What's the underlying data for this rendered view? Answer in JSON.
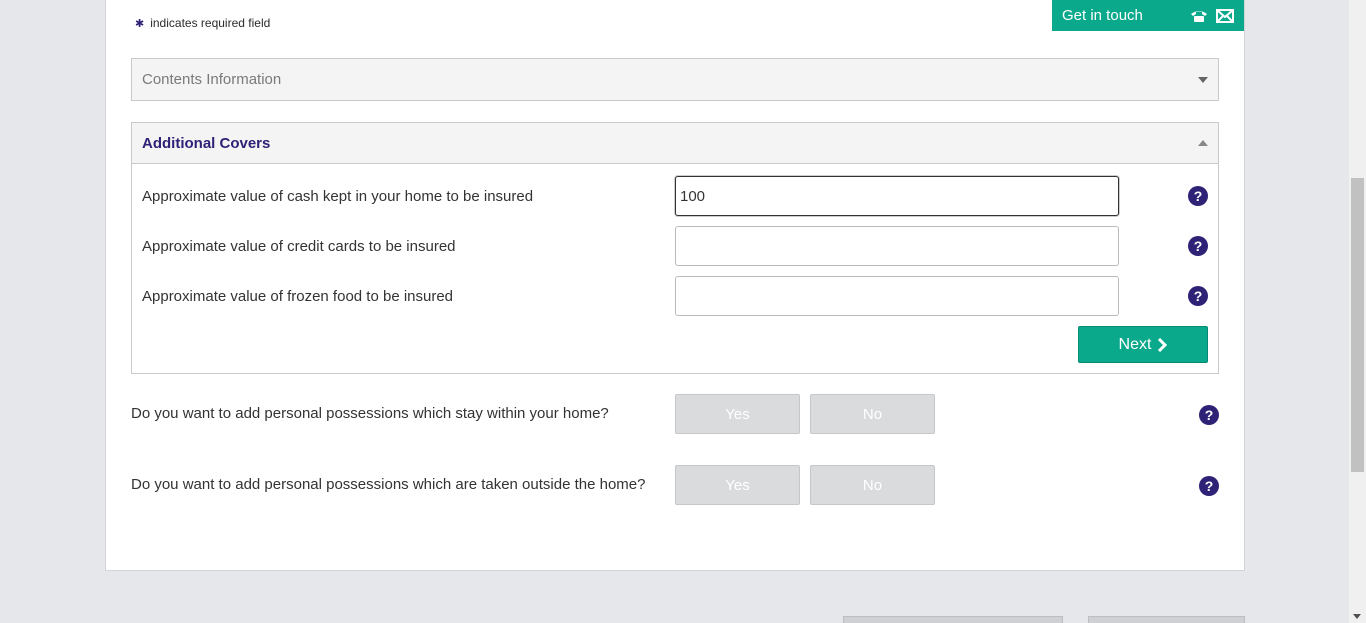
{
  "required_note": {
    "symbol": "✱",
    "text": "indicates required field"
  },
  "get_in_touch": {
    "label": "Get in touch",
    "phone_icon": "phone-icon",
    "mail_icon": "mail-icon"
  },
  "contents_section": {
    "title": "Contents Information"
  },
  "additional_section": {
    "title": "Additional Covers",
    "fields": [
      {
        "label": "Approximate value of cash kept in your home to be insured",
        "value": "100",
        "placeholder": ""
      },
      {
        "label": "Approximate value of credit cards to be insured",
        "value": "",
        "placeholder": ""
      },
      {
        "label": "Approximate value of frozen food to be insured",
        "value": "",
        "placeholder": ""
      }
    ],
    "next_label": "Next"
  },
  "questions": [
    {
      "text": "Do you want to add personal possessions which stay within your home?",
      "yes": "Yes",
      "no": "No"
    },
    {
      "text": "Do you want to add personal possessions which are taken outside the home?",
      "yes": "Yes",
      "no": "No"
    }
  ],
  "help_symbol": "?",
  "colors": {
    "brand_green": "#0aa98c",
    "brand_purple": "#2e2277"
  }
}
